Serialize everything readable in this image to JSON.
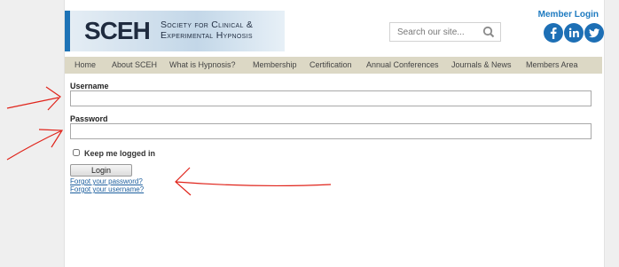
{
  "header": {
    "logo_mark": "SCEH",
    "logo_text_line1": "Society for Clinical &",
    "logo_text_line2": "Experimental Hypnosis",
    "member_login": "Member Login",
    "search_placeholder": "Search our site...",
    "social": [
      "facebook-icon",
      "linkedin-icon",
      "twitter-icon"
    ]
  },
  "nav": {
    "items": [
      "Home",
      "About SCEH",
      "What is Hypnosis?",
      "Membership",
      "Certification",
      "Annual Conferences",
      "Journals & News",
      "Members Area"
    ]
  },
  "form": {
    "username_label": "Username",
    "username_value": "",
    "password_label": "Password",
    "password_value": "",
    "remember_label": "Keep me logged in",
    "remember_checked": false,
    "login_button": "Login",
    "forgot_password": "Forgot your password?",
    "forgot_username": "Forgot your username?"
  },
  "colors": {
    "accent": "#1d6fb5",
    "nav_bg": "#dcd8c5",
    "annotation": "#e0241b"
  }
}
